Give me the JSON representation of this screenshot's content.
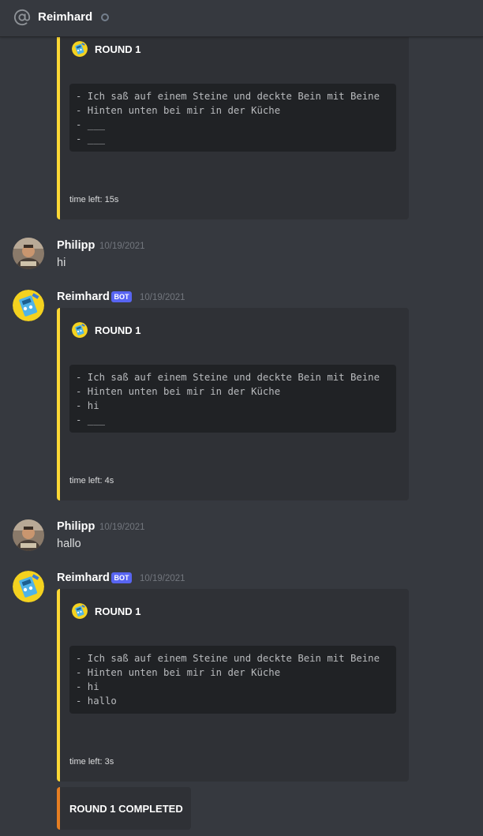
{
  "header": {
    "title": "Reimhard",
    "status": "offline"
  },
  "accent_colors": {
    "embed": "#fdd835",
    "completed": "#e67e22",
    "bot_tag": "#5865f2"
  },
  "messages": [
    {
      "embed": {
        "title": "ROUND 1",
        "lines": [
          "- Ich saß auf einem Steine und deckte Bein mit Beine",
          "- Hinten unten bei mir in der Küche",
          "- ___",
          "- ___"
        ],
        "footer": "time left: 15s"
      }
    },
    {
      "author": "Philipp",
      "timestamp": "10/19/2021",
      "text": "hi"
    },
    {
      "author": "Reimhard",
      "bot_tag": "BOT",
      "timestamp": "10/19/2021",
      "embed": {
        "title": "ROUND 1",
        "lines": [
          "- Ich saß auf einem Steine und deckte Bein mit Beine",
          "- Hinten unten bei mir in der Küche",
          "- hi",
          "- ___"
        ],
        "footer": "time left: 4s"
      }
    },
    {
      "author": "Philipp",
      "timestamp": "10/19/2021",
      "text": "hallo"
    },
    {
      "author": "Reimhard",
      "bot_tag": "BOT",
      "timestamp": "10/19/2021",
      "embed": {
        "title": "ROUND 1",
        "lines": [
          "- Ich saß auf einem Steine und deckte Bein mit Beine",
          "- Hinten unten bei mir in der Küche",
          "- hi",
          "- hallo"
        ],
        "footer": "time left: 3s"
      }
    },
    {
      "embed": {
        "title": "ROUND 1 COMPLETED"
      }
    }
  ]
}
